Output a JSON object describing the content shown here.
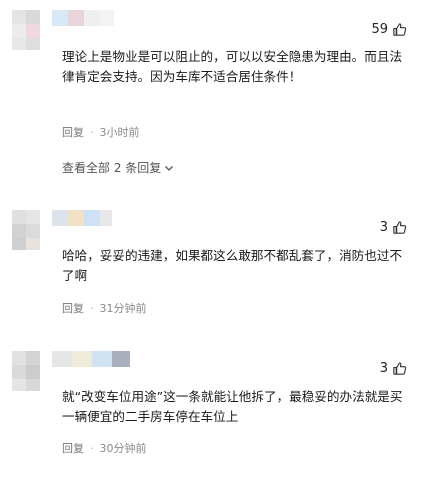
{
  "comments": [
    {
      "likes": "59",
      "text": "理论上是物业是可以阻止的，可以以安全隐患为理由。而且法律肯定会支持。因为车库不适合居住条件！",
      "reply_label": "回复",
      "separator": "·",
      "time": "3小时前",
      "view_all": "查看全部 2 条回复"
    },
    {
      "likes": "3",
      "text": "哈哈，妥妥的违建，如果都这么敢那不都乱套了，消防也过不了啊",
      "reply_label": "回复",
      "separator": "·",
      "time": "31分钟前"
    },
    {
      "likes": "3",
      "text": "就“改变车位用途”这一条就能让他拆了，最稳妥的办法就是买一辆便宜的二手房车停在车位上",
      "reply_label": "回复",
      "separator": "·",
      "time": "30分钟前"
    }
  ],
  "icons": {
    "like": "thumbs-up-icon",
    "expand": "chevron-down-icon"
  },
  "colors": {
    "text": "#1a1a1a",
    "meta": "#8a8a8a"
  }
}
